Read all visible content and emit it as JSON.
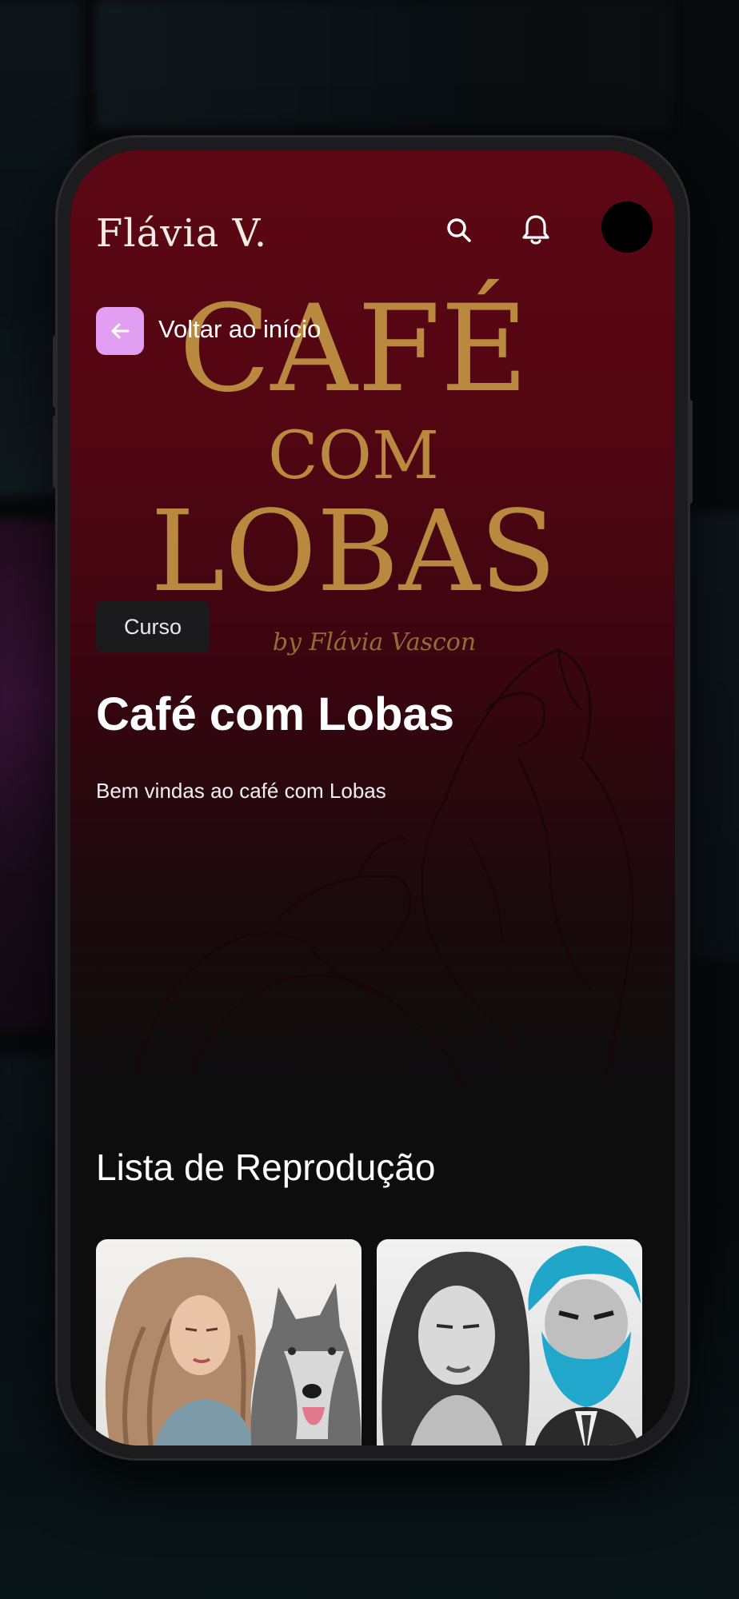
{
  "app": {
    "brand": "Flávia V.",
    "search_icon": "search-icon",
    "notification_icon": "bell-icon"
  },
  "nav": {
    "back_label": "Voltar ao início",
    "back_icon": "arrow-left-icon"
  },
  "course": {
    "banner_title_line1": "CAFÉ",
    "banner_title_line2": "COM",
    "banner_title_line3": "LOBAS",
    "banner_byline": "by Flávia Vascon",
    "tag": "Curso",
    "title": "Café com Lobas",
    "description": "Bem vindas ao café com Lobas"
  },
  "playlist": {
    "title": "Lista de Reprodução",
    "items": [
      {
        "thumbnail": "woman-with-wolf"
      },
      {
        "thumbnail": "woman-and-blue-bearded-man"
      }
    ]
  },
  "colors": {
    "hero_red": "#5d0714",
    "gold": "#b8893f",
    "accent_pink": "#e29ef0",
    "background": "#0d0d0e"
  }
}
